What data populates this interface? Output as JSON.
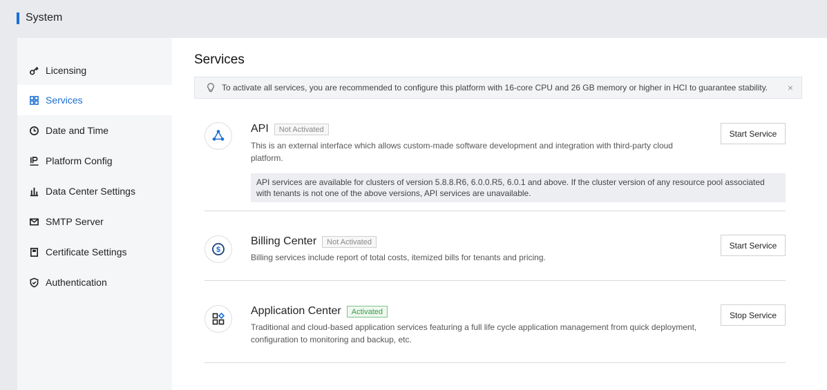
{
  "header": {
    "title": "System"
  },
  "sidebar": {
    "items": [
      {
        "label": "Licensing",
        "icon": "key-icon",
        "active": false
      },
      {
        "label": "Services",
        "icon": "grid-icon",
        "active": true
      },
      {
        "label": "Date and Time",
        "icon": "clock-icon",
        "active": false
      },
      {
        "label": "Platform Config",
        "icon": "ip-icon",
        "active": false
      },
      {
        "label": "Data Center Settings",
        "icon": "bar-chart-icon",
        "active": false
      },
      {
        "label": "SMTP Server",
        "icon": "mail-icon",
        "active": false
      },
      {
        "label": "Certificate Settings",
        "icon": "certificate-icon",
        "active": false
      },
      {
        "label": "Authentication",
        "icon": "shield-icon",
        "active": false
      }
    ]
  },
  "main": {
    "title": "Services",
    "notice": {
      "text": "To activate all services, you are recommended to configure this platform with 16-core CPU and 26 GB memory or higher in HCI to guarantee stability.",
      "close_label": "×"
    },
    "services": [
      {
        "name": "API",
        "status": "Not Activated",
        "description": "This is an external interface which allows custom-made software development and integration with third-party cloud platform.",
        "note": "API services are available for clusters of version 5.8.8.R6, 6.0.0.R5, 6.0.1 and above. If the cluster version of any resource pool associated with tenants is not one of the above versions, API services are unavailable.",
        "button": "Start Service",
        "icon": "api-icon"
      },
      {
        "name": "Billing Center",
        "status": "Not Activated",
        "description": "Billing services include report of total costs, itemized bills for tenants and pricing.",
        "button": "Start Service",
        "icon": "dollar-icon"
      },
      {
        "name": "Application Center",
        "status": "Activated",
        "description": "Traditional and cloud-based application services featuring a full life cycle application management from quick deployment, configuration to monitoring and backup, etc.",
        "button": "Stop Service",
        "icon": "apps-icon"
      }
    ]
  },
  "colors": {
    "accent": "#1a6fd6",
    "activated": "#3a9a4a"
  }
}
